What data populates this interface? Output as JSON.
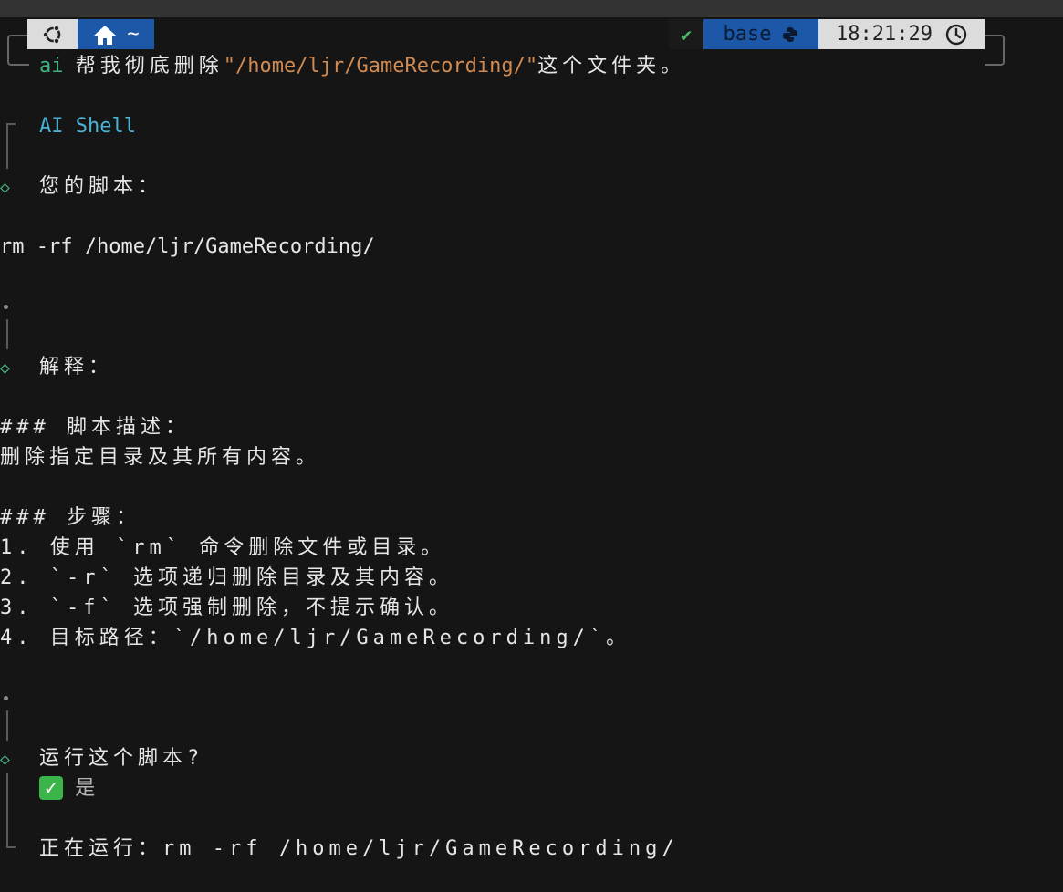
{
  "prompt": {
    "directory": "~",
    "status_icon": "✔",
    "env": "base",
    "time": "18:21:29"
  },
  "command": {
    "prefix": "ai",
    "text_before": "帮我彻底删除",
    "path": "\"/home/ljr/GameRecording/\"",
    "text_after": "这个文件夹。"
  },
  "output": {
    "app_title": "AI Shell",
    "script_label": "您的脚本：",
    "script": "rm -rf /home/ljr/GameRecording/",
    "explain_label": "解释：",
    "explanation_lines": [
      "### 脚本描述：",
      "删除指定目录及其所有内容。",
      "",
      "### 步骤：",
      "1. 使用 `rm` 命令删除文件或目录。",
      "2. `-r` 选项递归删除目录及其内容。",
      "3. `-f` 选项强制删除，不提示确认。",
      "4. 目标路径：`/home/ljr/GameRecording/`。"
    ],
    "run_question": "运行这个脚本?",
    "answer_icon": "✓",
    "answer": "是",
    "running": "正在运行：rm -rf /home/ljr/GameRecording/"
  }
}
